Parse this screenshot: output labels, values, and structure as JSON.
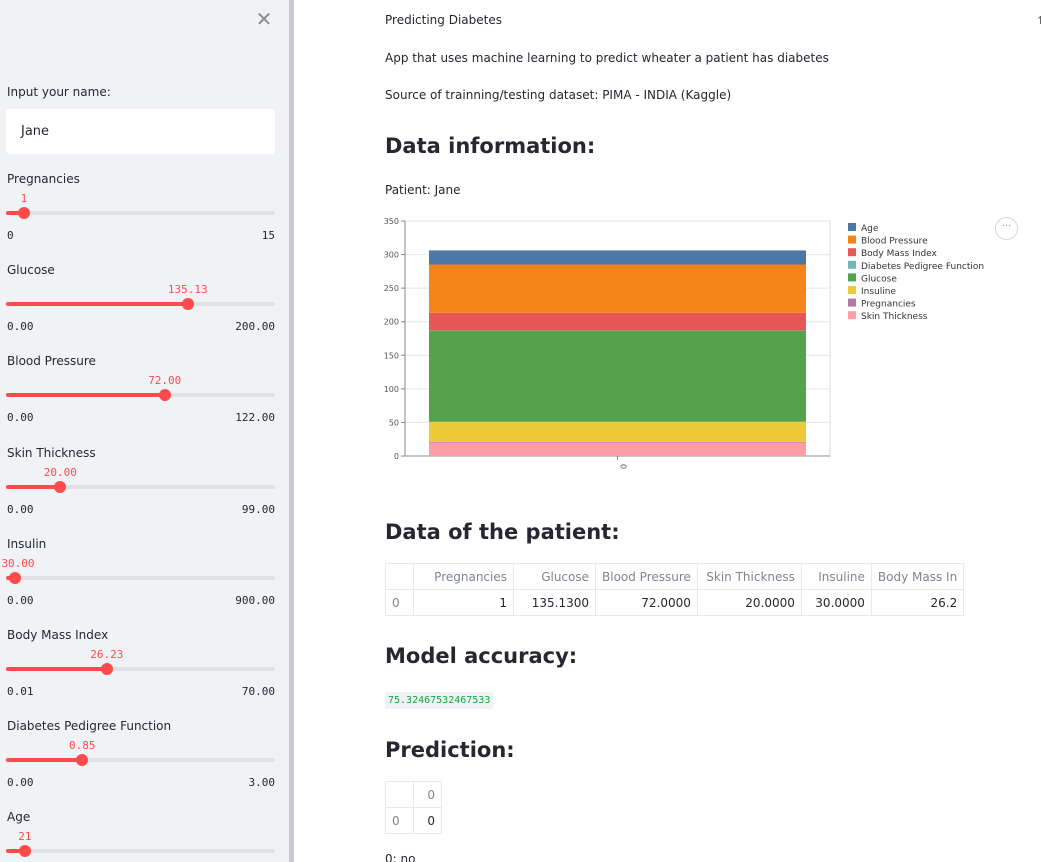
{
  "sidebar": {
    "close_glyph": "✕",
    "name_label": "Input your name:",
    "name_value": "Jane",
    "sliders": [
      {
        "label": "Pregnancies",
        "value": "1",
        "min": "0",
        "max": "15",
        "fraction": 0.0667
      },
      {
        "label": "Glucose",
        "value": "135.13",
        "min": "0.00",
        "max": "200.00",
        "fraction": 0.6757
      },
      {
        "label": "Blood Pressure",
        "value": "72.00",
        "min": "0.00",
        "max": "122.00",
        "fraction": 0.5902
      },
      {
        "label": "Skin Thickness",
        "value": "20.00",
        "min": "0.00",
        "max": "99.00",
        "fraction": 0.202
      },
      {
        "label": "Insulin",
        "value": "30.00",
        "min": "0.00",
        "max": "900.00",
        "fraction": 0.0333
      },
      {
        "label": "Body Mass Index",
        "value": "26.23",
        "min": "0.01",
        "max": "70.00",
        "fraction": 0.3747
      },
      {
        "label": "Diabetes Pedigree Function",
        "value": "0.85",
        "min": "0.00",
        "max": "3.00",
        "fraction": 0.2833
      },
      {
        "label": "Age",
        "value": "21",
        "min": "",
        "max": "",
        "fraction": 0.07
      }
    ]
  },
  "main": {
    "title": "Predicting Diabetes",
    "description": "App that uses machine learning to predict wheater a patient has diabetes",
    "source": "Source of trainning/testing dataset: PIMA - INDIA (Kaggle)",
    "data_info_heading": "Data information:",
    "patient_line": "Patient: Jane",
    "patient_heading": "Data of the patient:",
    "accuracy_heading": "Model accuracy:",
    "accuracy_value": "75.32467532467533",
    "prediction_heading": "Prediction:",
    "prediction_text": "0: no",
    "more_glyph": "···",
    "corner_glyph": "↑"
  },
  "patient_table": {
    "columns": [
      "",
      "Pregnancies",
      "Glucose",
      "Blood Pressure",
      "Skin Thickness",
      "Insuline",
      "Body Mass In"
    ],
    "rows": [
      [
        "0",
        "1",
        "135.1300",
        "72.0000",
        "20.0000",
        "30.0000",
        "26.2"
      ]
    ]
  },
  "prediction_table": {
    "columns": [
      "",
      "0"
    ],
    "rows": [
      [
        "0",
        "0"
      ]
    ]
  },
  "chart_data": {
    "type": "bar",
    "stacked": true,
    "categories": [
      "0"
    ],
    "series": [
      {
        "name": "Skin Thickness",
        "values": [
          20
        ],
        "color": "#ff9da6"
      },
      {
        "name": "Pregnancies",
        "values": [
          1
        ],
        "color": "#b279a2"
      },
      {
        "name": "Insuline",
        "values": [
          30
        ],
        "color": "#eeca3b"
      },
      {
        "name": "Glucose",
        "values": [
          135.13
        ],
        "color": "#54a24b"
      },
      {
        "name": "Diabetes Pedigree Function",
        "values": [
          0.85
        ],
        "color": "#72b7b2"
      },
      {
        "name": "Body Mass Index",
        "values": [
          26.23
        ],
        "color": "#e45756"
      },
      {
        "name": "Blood Pressure",
        "values": [
          72
        ],
        "color": "#f58518"
      },
      {
        "name": "Age",
        "values": [
          21
        ],
        "color": "#4c78a8"
      }
    ],
    "legend_order": [
      "Age",
      "Blood Pressure",
      "Body Mass Index",
      "Diabetes Pedigree Function",
      "Glucose",
      "Insuline",
      "Pregnancies",
      "Skin Thickness"
    ],
    "yticks": [
      0,
      50,
      100,
      150,
      200,
      250,
      300,
      350
    ],
    "ylim": [
      0,
      350
    ],
    "grid": true,
    "legend_position": "right"
  }
}
